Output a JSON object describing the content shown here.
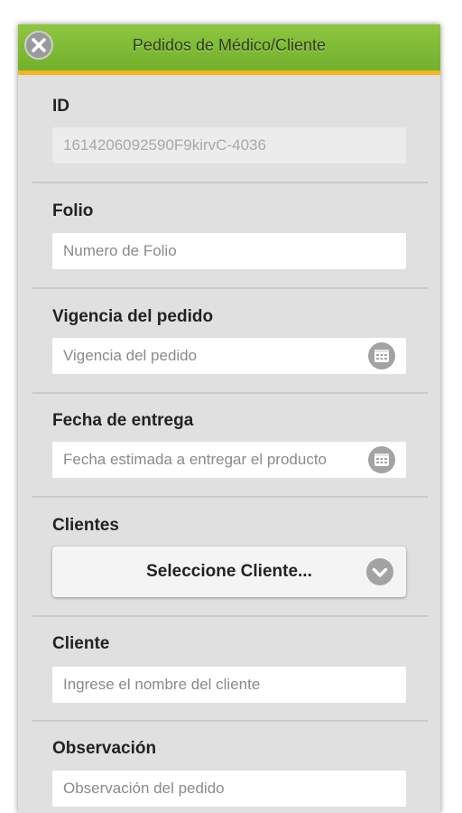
{
  "header": {
    "title": "Pedidos de Médico/Cliente",
    "close_icon": "close-icon"
  },
  "colors": {
    "header_green": "#8ec63f",
    "header_accent": "#f5b51f",
    "panel_bg": "#e0e0e0"
  },
  "form": {
    "id": {
      "label": "ID",
      "value": "1614206092590F9kirvC-4036"
    },
    "folio": {
      "label": "Folio",
      "placeholder": "Numero de Folio"
    },
    "vigencia": {
      "label": "Vigencia del pedido",
      "placeholder": "Vigencia del pedido",
      "icon": "calendar-icon"
    },
    "fecha_entrega": {
      "label": "Fecha de entrega",
      "placeholder": "Fecha estimada a entregar el producto",
      "icon": "calendar-icon"
    },
    "clientes": {
      "label": "Clientes",
      "selected": "Seleccione Cliente...",
      "icon": "chevron-down-icon"
    },
    "cliente": {
      "label": "Cliente",
      "placeholder": "Ingrese el nombre del cliente"
    },
    "observacion": {
      "label": "Observación",
      "placeholder": "Observación del pedido"
    }
  }
}
